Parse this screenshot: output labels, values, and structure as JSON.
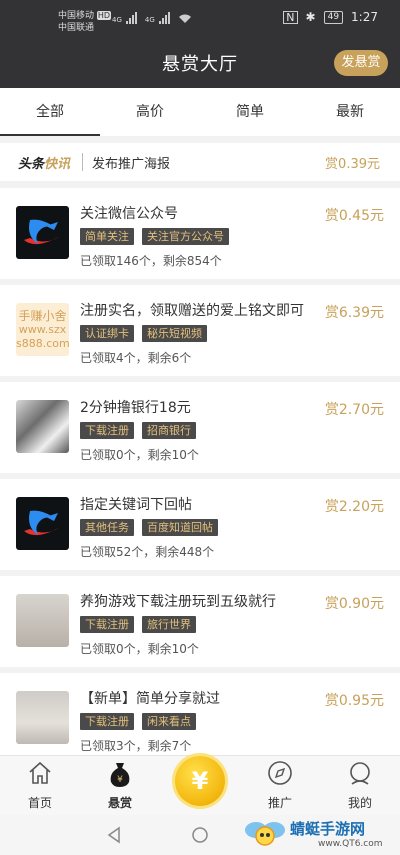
{
  "status_bar": {
    "carrier1": "中国移动",
    "carrier2": "中国联通",
    "hd": "HD",
    "net1": "4G",
    "net2": "4G",
    "battery": "49",
    "time": "1:27"
  },
  "header": {
    "title": "悬赏大厅",
    "post_button": "发悬赏"
  },
  "tabs": [
    "全部",
    "高价",
    "简单",
    "最新"
  ],
  "active_tab": "全部",
  "news": {
    "logo_a": "头条",
    "logo_b": "快讯",
    "text": "发布推广海报",
    "reward": "赏0.39元"
  },
  "tasks": [
    {
      "title": "关注微信公众号",
      "tags": [
        "简单关注",
        "关注官方公众号"
      ],
      "progress": "已领取146个，剩余854个",
      "reward": "赏0.45元",
      "thumb": "app-logo"
    },
    {
      "title": "注册实名，领取赠送的爱上铭文即可",
      "tags": [
        "认证绑卡",
        "秘乐短视频"
      ],
      "progress": "已领取4个，剩余6个",
      "reward": "赏6.39元",
      "thumb": "text-tile",
      "thumb_text": [
        "手赚小舍",
        "www.szx",
        "s888.com"
      ]
    },
    {
      "title": "2分钟撸银行18元",
      "tags": [
        "下载注册",
        "招商银行"
      ],
      "progress": "已领取0个，剩余10个",
      "reward": "赏2.70元",
      "thumb": "anime-art"
    },
    {
      "title": "指定关键词下回帖",
      "tags": [
        "其他任务",
        "百度知道回帖"
      ],
      "progress": "已领取52个，剩余448个",
      "reward": "赏2.20元",
      "thumb": "app-logo"
    },
    {
      "title": "养狗游戏下载注册玩到五级就行",
      "tags": [
        "下载注册",
        "旅行世界"
      ],
      "progress": "已领取0个，剩余10个",
      "reward": "赏0.90元",
      "thumb": "couple-photo"
    },
    {
      "title": "【新单】简单分享就过",
      "tags": [
        "下载注册",
        "闲来看点"
      ],
      "progress": "已领取3个，剩余7个",
      "reward": "赏0.95元",
      "thumb": "girl-photo"
    }
  ],
  "bottom_nav": {
    "home": "首页",
    "reward": "悬赏",
    "center_symbol": "¥",
    "promote": "推广",
    "mine": "我的"
  },
  "watermark": {
    "text": "蜻蜓手游网",
    "url": "www.QT6.com"
  },
  "colors": {
    "header_bg": "#333336",
    "accent_gold": "#c8a15a",
    "tag_bg": "#4a4a4a",
    "tag_text": "#e3c07d"
  }
}
